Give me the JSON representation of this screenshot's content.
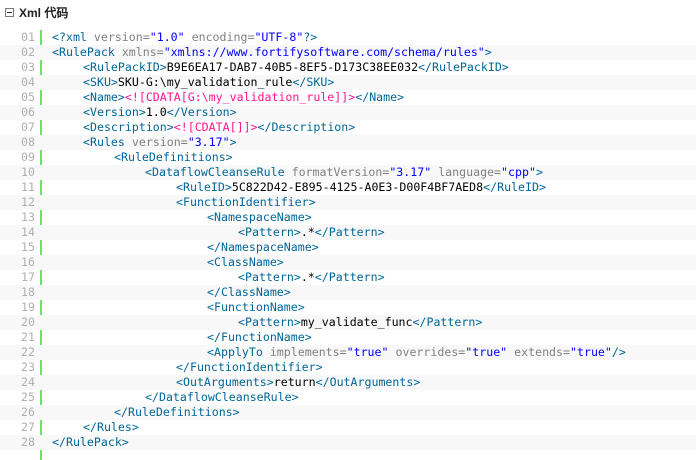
{
  "header": {
    "title": "Xml 代码",
    "collapse_icon": "collapse-minus-icon"
  },
  "colors": {
    "tag": "#006699",
    "attr": "#808080",
    "string": "#0000ff",
    "cdata": "#ff1493",
    "text": "#000000",
    "gutter_border": "#6ce26c",
    "line_number": "#afafaf"
  },
  "lines": [
    {
      "num": "01",
      "indent": 0,
      "tokens": [
        {
          "t": "tag",
          "v": "<?"
        },
        {
          "t": "tag",
          "v": "xml "
        },
        {
          "t": "attr",
          "v": "version="
        },
        {
          "t": "str",
          "v": "\"1.0\""
        },
        {
          "t": "attr",
          "v": " encoding="
        },
        {
          "t": "str",
          "v": "\"UTF-8\""
        },
        {
          "t": "tag",
          "v": "?>"
        }
      ]
    },
    {
      "num": "02",
      "indent": 0,
      "tokens": [
        {
          "t": "tag",
          "v": "<RulePack "
        },
        {
          "t": "attr",
          "v": "xmlns="
        },
        {
          "t": "str",
          "v": "\"xmlns://www.fortifysoftware.com/schema/rules\""
        },
        {
          "t": "tag",
          "v": ">"
        }
      ]
    },
    {
      "num": "03",
      "indent": 1,
      "tokens": [
        {
          "t": "tag",
          "v": "<RulePackID>"
        },
        {
          "t": "text",
          "v": "B9E6EA17-DAB7-40B5-8EF5-D173C38EE032"
        },
        {
          "t": "tag",
          "v": "</RulePackID>"
        }
      ]
    },
    {
      "num": "04",
      "indent": 1,
      "tokens": [
        {
          "t": "tag",
          "v": "<SKU>"
        },
        {
          "t": "text",
          "v": "SKU-G:\\my_validation_rule"
        },
        {
          "t": "tag",
          "v": "</SKU>"
        }
      ]
    },
    {
      "num": "05",
      "indent": 1,
      "tokens": [
        {
          "t": "tag",
          "v": "<Name>"
        },
        {
          "t": "cdata",
          "v": "<![CDATA[G:\\my_validation_rule]]>"
        },
        {
          "t": "tag",
          "v": "</Name>"
        }
      ]
    },
    {
      "num": "06",
      "indent": 1,
      "tokens": [
        {
          "t": "tag",
          "v": "<Version>"
        },
        {
          "t": "text",
          "v": "1.0"
        },
        {
          "t": "tag",
          "v": "</Version>"
        }
      ]
    },
    {
      "num": "07",
      "indent": 1,
      "tokens": [
        {
          "t": "tag",
          "v": "<Description>"
        },
        {
          "t": "cdata",
          "v": "<![CDATA[]]>"
        },
        {
          "t": "tag",
          "v": "</Description>"
        }
      ]
    },
    {
      "num": "08",
      "indent": 1,
      "tokens": [
        {
          "t": "tag",
          "v": "<Rules "
        },
        {
          "t": "attr",
          "v": "version="
        },
        {
          "t": "str",
          "v": "\"3.17\""
        },
        {
          "t": "tag",
          "v": ">"
        }
      ]
    },
    {
      "num": "09",
      "indent": 2,
      "tokens": [
        {
          "t": "tag",
          "v": "<RuleDefinitions>"
        }
      ]
    },
    {
      "num": "10",
      "indent": 3,
      "tokens": [
        {
          "t": "tag",
          "v": "<DataflowCleanseRule "
        },
        {
          "t": "attr",
          "v": "formatVersion="
        },
        {
          "t": "str",
          "v": "\"3.17\""
        },
        {
          "t": "attr",
          "v": " language="
        },
        {
          "t": "str",
          "v": "\"cpp\""
        },
        {
          "t": "tag",
          "v": ">"
        }
      ]
    },
    {
      "num": "11",
      "indent": 4,
      "tokens": [
        {
          "t": "tag",
          "v": "<RuleID>"
        },
        {
          "t": "text",
          "v": "5C822D42-E895-4125-A0E3-D00F4BF7AED8"
        },
        {
          "t": "tag",
          "v": "</RuleID>"
        }
      ]
    },
    {
      "num": "12",
      "indent": 4,
      "tokens": [
        {
          "t": "tag",
          "v": "<FunctionIdentifier>"
        }
      ]
    },
    {
      "num": "13",
      "indent": 5,
      "tokens": [
        {
          "t": "tag",
          "v": "<NamespaceName>"
        }
      ]
    },
    {
      "num": "14",
      "indent": 6,
      "tokens": [
        {
          "t": "tag",
          "v": "<Pattern>"
        },
        {
          "t": "text",
          "v": ".*"
        },
        {
          "t": "tag",
          "v": "</Pattern>"
        }
      ]
    },
    {
      "num": "15",
      "indent": 5,
      "tokens": [
        {
          "t": "tag",
          "v": "</NamespaceName>"
        }
      ]
    },
    {
      "num": "16",
      "indent": 5,
      "tokens": [
        {
          "t": "tag",
          "v": "<ClassName>"
        }
      ]
    },
    {
      "num": "17",
      "indent": 6,
      "tokens": [
        {
          "t": "tag",
          "v": "<Pattern>"
        },
        {
          "t": "text",
          "v": ".*"
        },
        {
          "t": "tag",
          "v": "</Pattern>"
        }
      ]
    },
    {
      "num": "18",
      "indent": 5,
      "tokens": [
        {
          "t": "tag",
          "v": "</ClassName>"
        }
      ]
    },
    {
      "num": "19",
      "indent": 5,
      "tokens": [
        {
          "t": "tag",
          "v": "<FunctionName>"
        }
      ]
    },
    {
      "num": "20",
      "indent": 6,
      "tokens": [
        {
          "t": "tag",
          "v": "<Pattern>"
        },
        {
          "t": "text",
          "v": "my_validate_func"
        },
        {
          "t": "tag",
          "v": "</Pattern>"
        }
      ]
    },
    {
      "num": "21",
      "indent": 5,
      "tokens": [
        {
          "t": "tag",
          "v": "</FunctionName>"
        }
      ]
    },
    {
      "num": "22",
      "indent": 5,
      "tokens": [
        {
          "t": "tag",
          "v": "<ApplyTo "
        },
        {
          "t": "attr",
          "v": "implements="
        },
        {
          "t": "str",
          "v": "\"true\""
        },
        {
          "t": "attr",
          "v": " overrides="
        },
        {
          "t": "str",
          "v": "\"true\""
        },
        {
          "t": "attr",
          "v": " extends="
        },
        {
          "t": "str",
          "v": "\"true\""
        },
        {
          "t": "tag",
          "v": "/>"
        }
      ]
    },
    {
      "num": "23",
      "indent": 4,
      "tokens": [
        {
          "t": "tag",
          "v": "</FunctionIdentifier>"
        }
      ]
    },
    {
      "num": "24",
      "indent": 4,
      "tokens": [
        {
          "t": "tag",
          "v": "<OutArguments>"
        },
        {
          "t": "text",
          "v": "return"
        },
        {
          "t": "tag",
          "v": "</OutArguments>"
        }
      ]
    },
    {
      "num": "25",
      "indent": 3,
      "tokens": [
        {
          "t": "tag",
          "v": "</DataflowCleanseRule>"
        }
      ]
    },
    {
      "num": "26",
      "indent": 2,
      "tokens": [
        {
          "t": "tag",
          "v": "</RuleDefinitions>"
        }
      ]
    },
    {
      "num": "27",
      "indent": 1,
      "tokens": [
        {
          "t": "tag",
          "v": "</Rules>"
        }
      ]
    },
    {
      "num": "28",
      "indent": 0,
      "tokens": [
        {
          "t": "tag",
          "v": "</RulePack>"
        }
      ]
    }
  ]
}
